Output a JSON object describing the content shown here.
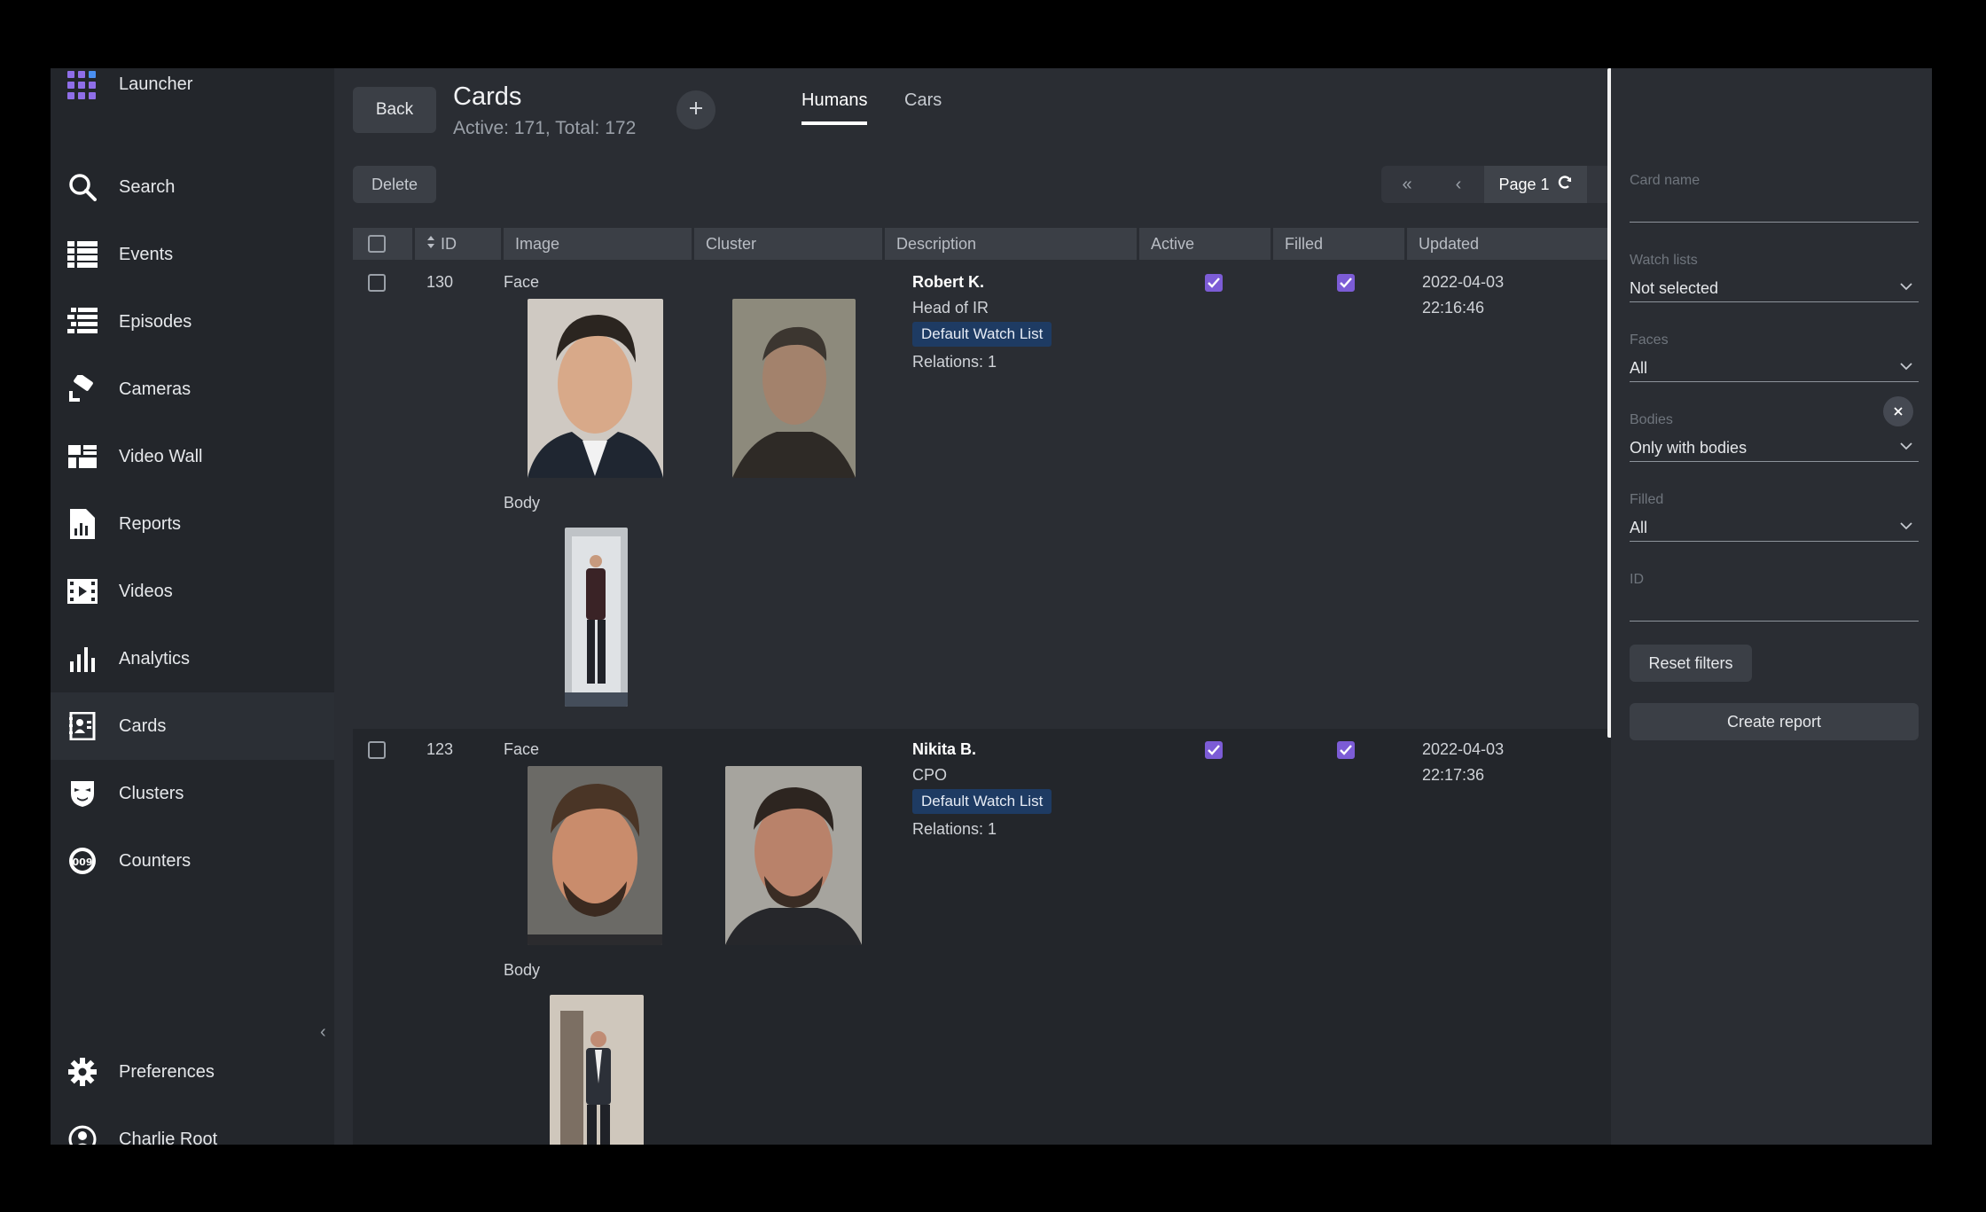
{
  "sidebar": {
    "launcher": "Launcher",
    "items": [
      {
        "label": "Search",
        "icon": "search-icon"
      },
      {
        "label": "Events",
        "icon": "events-icon"
      },
      {
        "label": "Episodes",
        "icon": "episodes-icon"
      },
      {
        "label": "Cameras",
        "icon": "camera-icon"
      },
      {
        "label": "Video Wall",
        "icon": "video-wall-icon"
      },
      {
        "label": "Reports",
        "icon": "report-icon"
      },
      {
        "label": "Videos",
        "icon": "video-icon"
      },
      {
        "label": "Analytics",
        "icon": "analytics-icon"
      },
      {
        "label": "Cards",
        "icon": "cards-icon"
      },
      {
        "label": "Clusters",
        "icon": "clusters-icon"
      },
      {
        "label": "Counters",
        "icon": "counter-icon"
      }
    ],
    "preferences": "Preferences",
    "user": "Charlie Root",
    "active": "Cards"
  },
  "header": {
    "back": "Back",
    "title": "Cards",
    "subtitle": "Active: 171, Total: 172",
    "tabs": [
      "Humans",
      "Cars"
    ],
    "active_tab": "Humans"
  },
  "toolbar": {
    "delete": "Delete",
    "page": "Page 1"
  },
  "table": {
    "columns": [
      "ID",
      "Image",
      "Cluster",
      "Description",
      "Active",
      "Filled",
      "Updated"
    ],
    "rows": [
      {
        "id": "130",
        "face_label": "Face",
        "body_label": "Body",
        "name": "Robert K.",
        "role": "Head of IR",
        "watch_list": "Default Watch List",
        "relations": "Relations: 1",
        "active": true,
        "filled": true,
        "date": "2022-04-03",
        "time": "22:16:46"
      },
      {
        "id": "123",
        "face_label": "Face",
        "body_label": "Body",
        "name": "Nikita B.",
        "role": "CPO",
        "watch_list": "Default Watch List",
        "relations": "Relations: 1",
        "active": true,
        "filled": true,
        "date": "2022-04-03",
        "time": "22:17:36"
      }
    ]
  },
  "filters": {
    "card_name": {
      "label": "Card name",
      "value": ""
    },
    "watch_lists": {
      "label": "Watch lists",
      "value": "Not selected"
    },
    "faces": {
      "label": "Faces",
      "value": "All"
    },
    "bodies": {
      "label": "Bodies",
      "value": "Only with bodies"
    },
    "filled": {
      "label": "Filled",
      "value": "All"
    },
    "id": {
      "label": "ID",
      "value": ""
    },
    "reset": "Reset filters",
    "create_report": "Create report"
  },
  "colors": {
    "accent": "#7c5cd6",
    "badge": "#1e3b63",
    "background": "#2a2d33",
    "sidebar": "#23262b"
  }
}
